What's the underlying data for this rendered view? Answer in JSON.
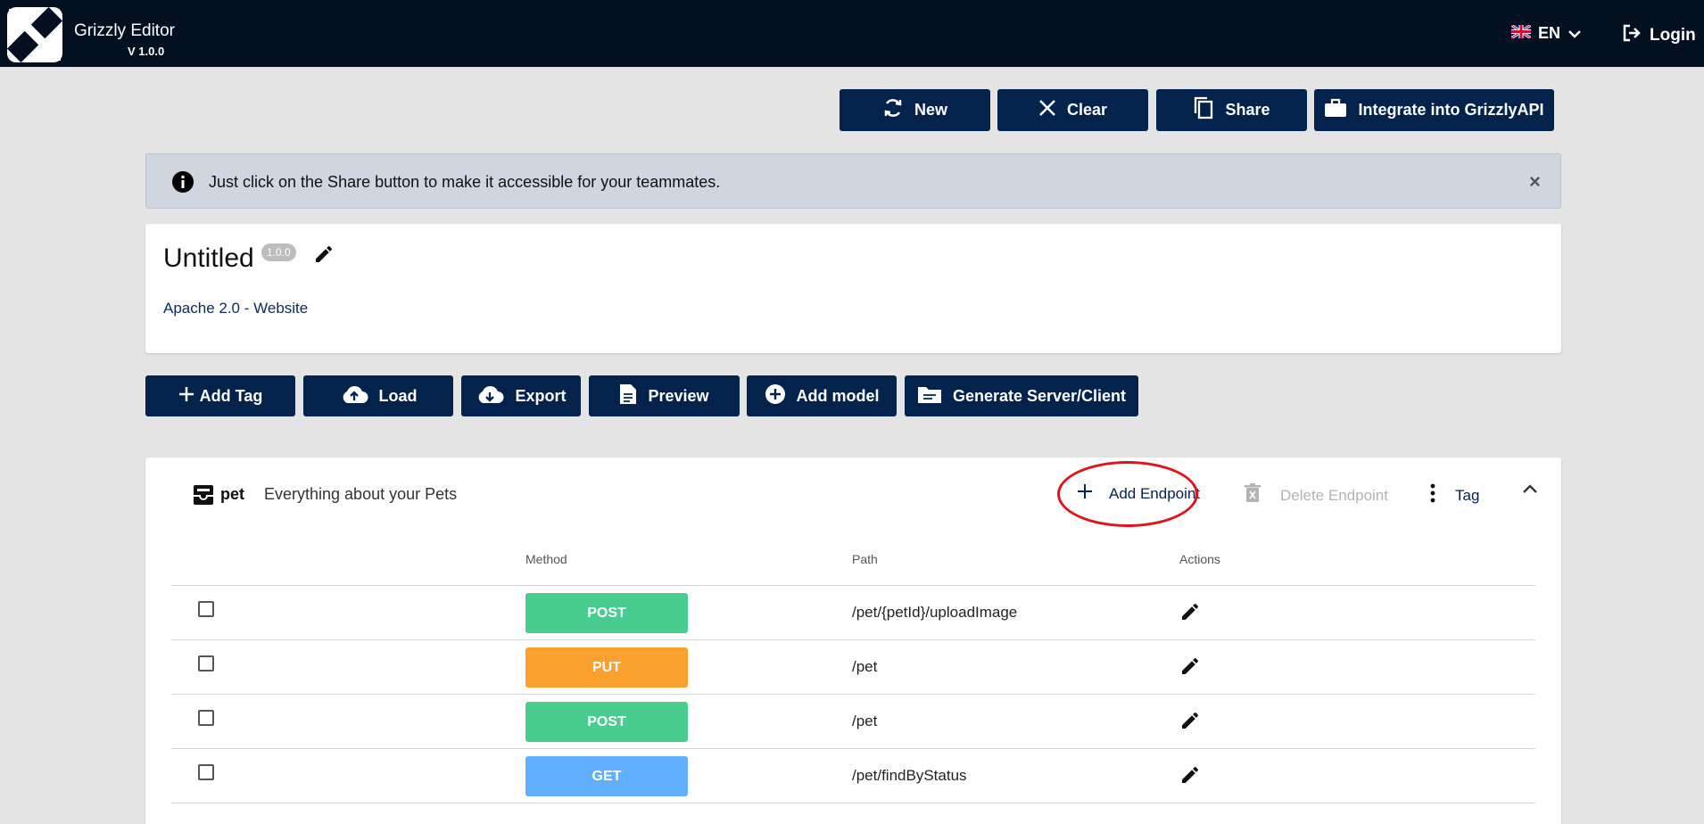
{
  "app": {
    "name": "Grizzly Editor",
    "version": "V 1.0.0",
    "language": "EN",
    "login_label": "Login"
  },
  "toolbar": {
    "new_label": "New",
    "clear_label": "Clear",
    "share_label": "Share",
    "integrate_label": "Integrate into GrizzlyAPI"
  },
  "alert": {
    "message": "Just click on the Share button to make it accessible for your teammates.",
    "close": "×"
  },
  "doc": {
    "title": "Untitled",
    "version": "1.0.0",
    "license": "Apache 2.0 - Website"
  },
  "actions": {
    "add_tag": "Add Tag",
    "load": "Load",
    "export": "Export",
    "preview": "Preview",
    "add_model": "Add model",
    "generate": "Generate Server/Client"
  },
  "tag": {
    "name": "pet",
    "description": "Everything about your Pets",
    "add_endpoint": "Add Endpoint",
    "delete_endpoint": "Delete Endpoint",
    "tag_menu": "Tag"
  },
  "table": {
    "headers": {
      "method": "Method",
      "path": "Path",
      "actions": "Actions"
    },
    "rows": [
      {
        "method": "POST",
        "path": "/pet/{petId}/uploadImage",
        "color": "#49cc90"
      },
      {
        "method": "PUT",
        "path": "/pet",
        "color": "#fca130"
      },
      {
        "method": "POST",
        "path": "/pet",
        "color": "#49cc90"
      },
      {
        "method": "GET",
        "path": "/pet/findByStatus",
        "color": "#61affe"
      }
    ]
  },
  "colors": {
    "header_bg": "#03101f",
    "button_bg": "#03224c",
    "alert_bg": "#cfd6e0",
    "highlight": "#e0141c"
  }
}
